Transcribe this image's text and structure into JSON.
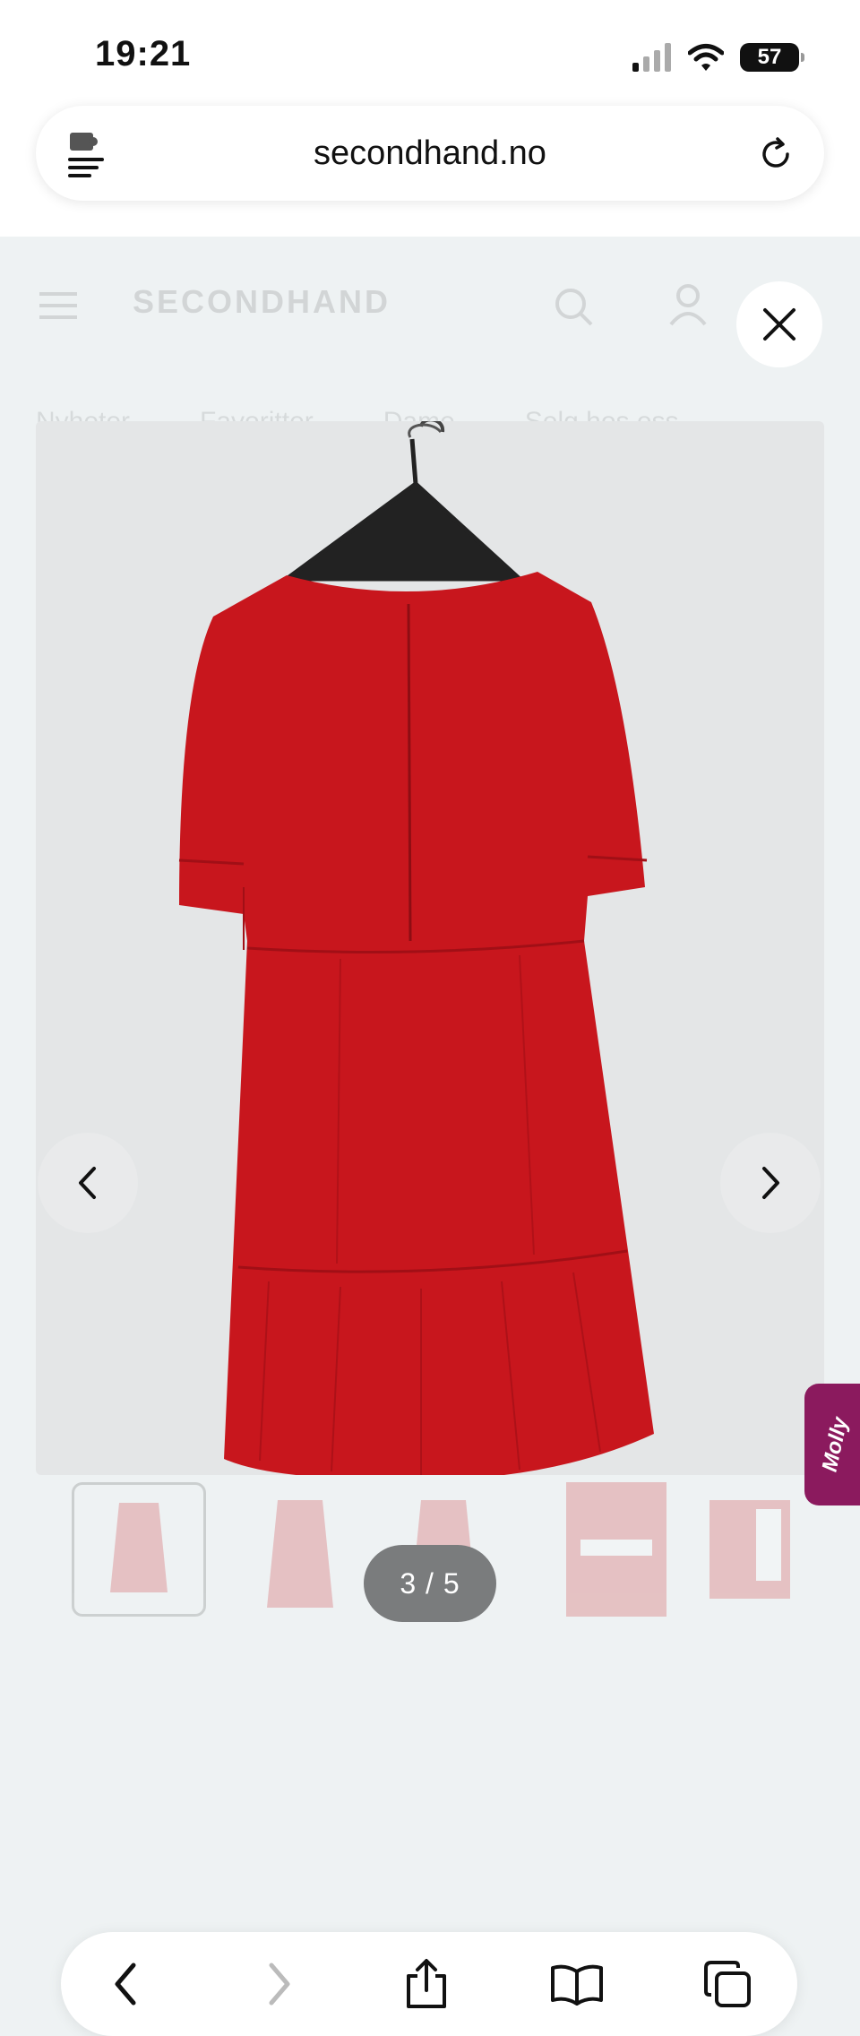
{
  "status_bar": {
    "time": "19:21",
    "battery": "57"
  },
  "browser": {
    "url": "secondhand.no"
  },
  "site": {
    "logo": "SECONDHAND",
    "nav_tabs": [
      "Nyheter",
      "Favoritter",
      "Dame",
      "Selg hos oss"
    ]
  },
  "gallery": {
    "counter": "3 / 5",
    "current_index": 3,
    "total": 5
  },
  "molly": {
    "label": "Molly"
  },
  "colors": {
    "dress": "#c8161d",
    "molly_tab": "#8b1a5e",
    "counter_bg": "#7a7c7d"
  }
}
